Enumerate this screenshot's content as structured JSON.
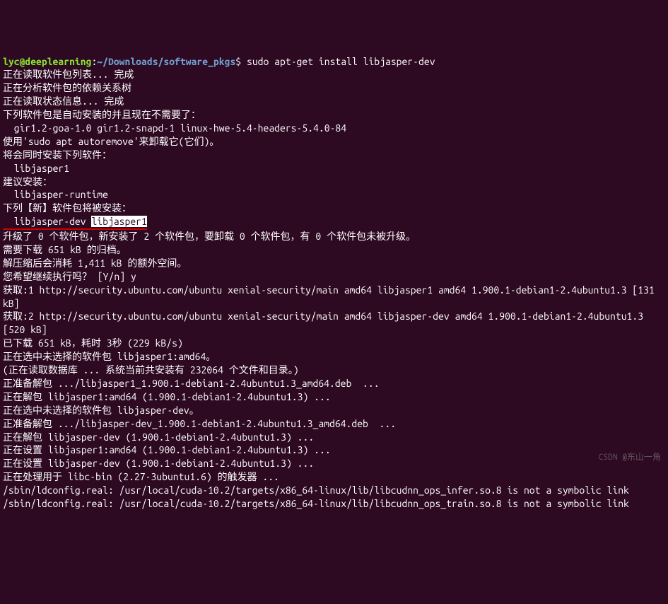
{
  "prompt": {
    "user_host": "lyc@deeplearning",
    "separator": ":",
    "path": "~/Downloads/software_pkgs",
    "dollar": "$",
    "command": " sudo apt-get install libjasper-dev"
  },
  "lines": {
    "l1": "正在读取软件包列表... 完成",
    "l2": "正在分析软件包的依赖关系树",
    "l3": "正在读取状态信息... 完成",
    "l4": "下列软件包是自动安装的并且现在不需要了：",
    "l5": "  gir1.2-goa-1.0 gir1.2-snapd-1 linux-hwe-5.4-headers-5.4.0-84",
    "l6": "使用'sudo apt autoremove'来卸载它(它们)。",
    "l7": "将会同时安装下列软件：",
    "l8": "  libjasper1",
    "l9": "建议安装：",
    "l10": "  libjasper-runtime",
    "l11": "下列【新】软件包将被安装：",
    "l12a": "  libjasper-dev ",
    "l12b": "libjasper1",
    "l13": "升级了 0 个软件包，新安装了 2 个软件包，要卸载 0 个软件包，有 0 个软件包未被升级。",
    "l14": "需要下载 651 kB 的归档。",
    "l15": "解压缩后会消耗 1,411 kB 的额外空间。",
    "l16": "您希望继续执行吗？ [Y/n] y",
    "l17": "获取:1 http://security.ubuntu.com/ubuntu xenial-security/main amd64 libjasper1 amd64 1.900.1-debian1-2.4ubuntu1.3 [131 kB]",
    "l18": "获取:2 http://security.ubuntu.com/ubuntu xenial-security/main amd64 libjasper-dev amd64 1.900.1-debian1-2.4ubuntu1.3 [520 kB]",
    "l19": "已下载 651 kB，耗时 3秒 (229 kB/s)",
    "l20": "正在选中未选择的软件包 libjasper1:amd64。",
    "l21": "(正在读取数据库 ... 系统当前共安装有 232064 个文件和目录。)",
    "l22": "正准备解包 .../libjasper1_1.900.1-debian1-2.4ubuntu1.3_amd64.deb  ...",
    "l23": "正在解包 libjasper1:amd64 (1.900.1-debian1-2.4ubuntu1.3) ...",
    "l24": "正在选中未选择的软件包 libjasper-dev。",
    "l25": "正准备解包 .../libjasper-dev_1.900.1-debian1-2.4ubuntu1.3_amd64.deb  ...",
    "l26": "正在解包 libjasper-dev (1.900.1-debian1-2.4ubuntu1.3) ...",
    "l27": "正在设置 libjasper1:amd64 (1.900.1-debian1-2.4ubuntu1.3) ...",
    "l28": "正在设置 libjasper-dev (1.900.1-debian1-2.4ubuntu1.3) ...",
    "l29": "正在处理用于 libc-bin (2.27-3ubuntu1.6) 的触发器 ...",
    "l30": "/sbin/ldconfig.real: /usr/local/cuda-10.2/targets/x86_64-linux/lib/libcudnn_ops_infer.so.8 is not a symbolic link",
    "l31": "",
    "l32": "/sbin/ldconfig.real: /usr/local/cuda-10.2/targets/x86_64-linux/lib/libcudnn_ops_train.so.8 is not a symbolic link"
  },
  "watermark": "CSDN @东山一角"
}
